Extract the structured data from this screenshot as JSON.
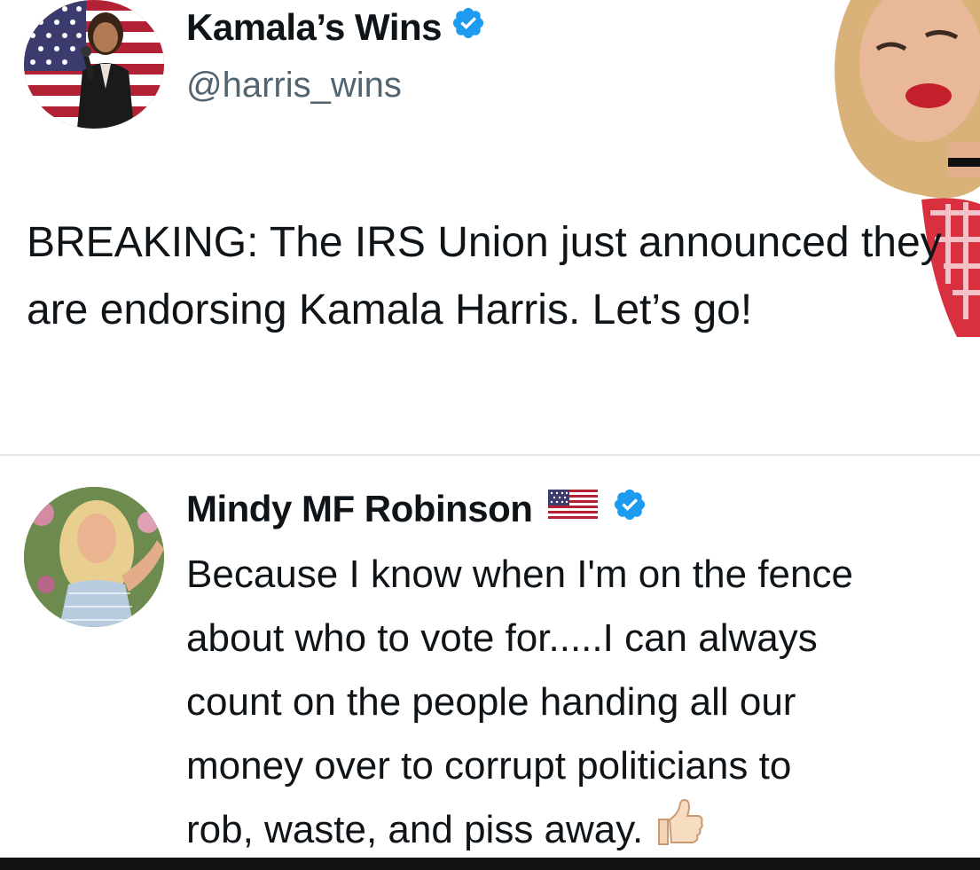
{
  "tweet1": {
    "display_name": "Kamala’s Wins",
    "handle": "@harris_wins",
    "verified_icon": "verified-badge-icon",
    "text": "BREAKING: The IRS Union just announced they are endorsing Kamala Harris. Let’s go!"
  },
  "tweet2": {
    "display_name": "Mindy MF Robinson",
    "flag_icon": "us-flag-icon",
    "verified_icon": "verified-badge-icon",
    "text": "Because I know when I'm on the fence\nabout who to vote for.....I can always\ncount on the people handing all our\nmoney over to corrupt politicians to\nrob, waste, and piss away.",
    "trailing_icon": "thumbs-up-icon"
  },
  "colors": {
    "verified_blue": "#1d9bf0",
    "handle_gray": "#536471",
    "text": "#0f1419"
  }
}
